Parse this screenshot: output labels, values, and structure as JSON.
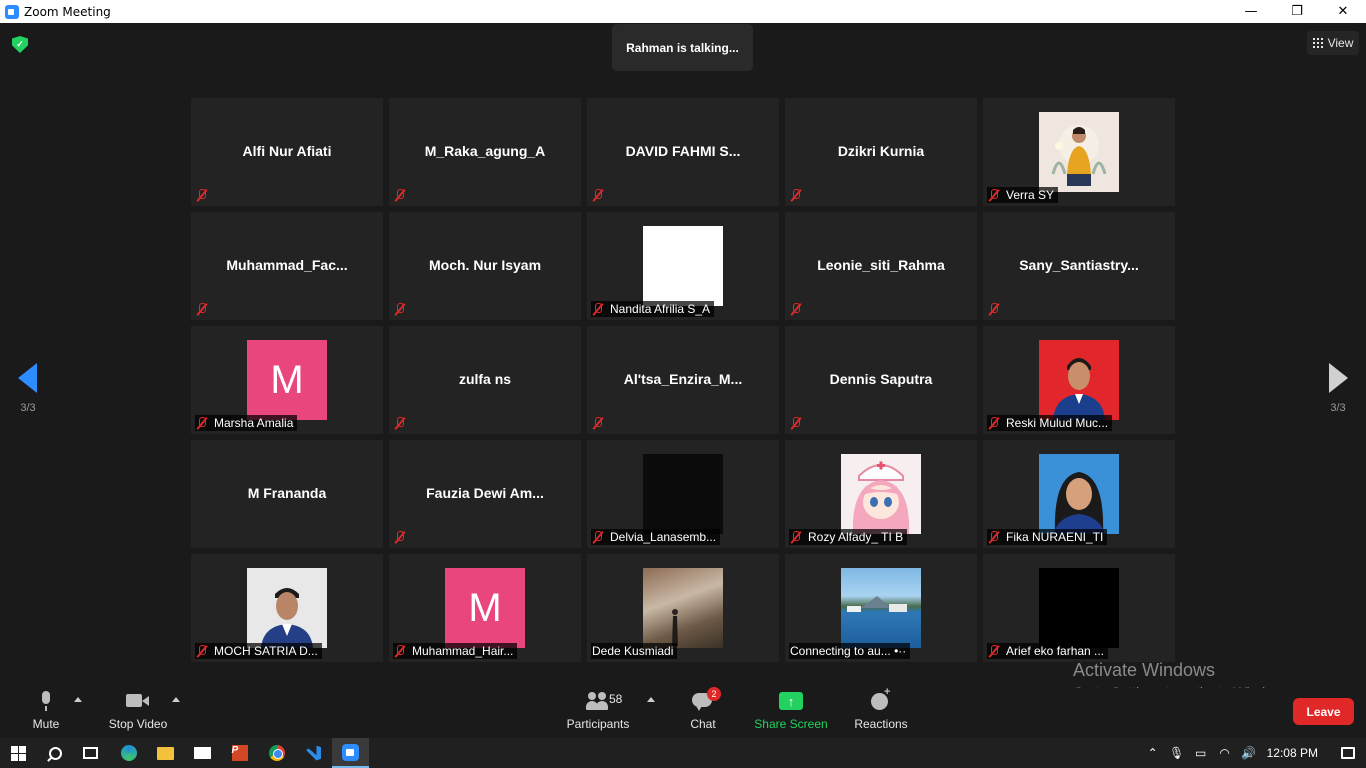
{
  "window": {
    "title": "Zoom Meeting",
    "minimize": "—",
    "restore": "❐",
    "close": "✕"
  },
  "header": {
    "security": "✓",
    "talking": "Rahman is talking...",
    "view_label": "View"
  },
  "nav": {
    "left_page": "3/3",
    "right_page": "3/3"
  },
  "tiles": [
    {
      "name": "Alfi Nur Afiati",
      "label": "",
      "muted": true
    },
    {
      "name": "M_Raka_agung_A",
      "label": "",
      "muted": true
    },
    {
      "name": "DAVID FAHMI S...",
      "label": "",
      "muted": true
    },
    {
      "name": "Dzikri Kurnia",
      "label": "",
      "muted": true
    },
    {
      "name": "",
      "label": "Verra SY",
      "muted": true,
      "avatar": "photo"
    },
    {
      "name": "Muhammad_Fac...",
      "label": "",
      "muted": true
    },
    {
      "name": "Moch. Nur Isyam",
      "label": "",
      "muted": true
    },
    {
      "name": "",
      "label": "Nandita Afrilia S_A",
      "muted": true,
      "avatar": "white"
    },
    {
      "name": "Leonie_siti_Rahma",
      "label": "",
      "muted": true
    },
    {
      "name": "Sany_Santiastry...",
      "label": "",
      "muted": true
    },
    {
      "name": "",
      "label": "Marsha Amalia",
      "muted": true,
      "avatar": "M"
    },
    {
      "name": "zulfa ns",
      "label": "",
      "muted": true
    },
    {
      "name": "Al'tsa_Enzira_M...",
      "label": "",
      "muted": true
    },
    {
      "name": "Dennis Saputra",
      "label": "",
      "muted": true
    },
    {
      "name": "",
      "label": "Reski Mulud Muc...",
      "muted": true,
      "avatar": "photo"
    },
    {
      "name": "M Frananda",
      "label": "",
      "muted": false
    },
    {
      "name": "Fauzia Dewi Am...",
      "label": "",
      "muted": true
    },
    {
      "name": "",
      "label": "Delvia_Lanasemb...",
      "muted": true,
      "avatar": "dark"
    },
    {
      "name": "",
      "label": "Rozy Alfady_ TI B",
      "muted": true,
      "avatar": "photo"
    },
    {
      "name": "",
      "label": "Fika NURAENI_TI",
      "muted": true,
      "avatar": "photo"
    },
    {
      "name": "",
      "label": "MOCH SATRIA D...",
      "muted": true,
      "avatar": "photo"
    },
    {
      "name": "",
      "label": "Muhammad_Hair...",
      "muted": true,
      "avatar": "M"
    },
    {
      "name": "",
      "label": "Dede Kusmiadi",
      "muted": false,
      "avatar": "photo"
    },
    {
      "name": "",
      "label": "Connecting to au... •··",
      "muted": false,
      "avatar": "photo"
    },
    {
      "name": "",
      "label": "Arief eko farhan ...",
      "muted": true,
      "avatar": "black"
    }
  ],
  "avatar_letters": {
    "marsha": "M",
    "hair": "M"
  },
  "toolbar": {
    "mute": "Mute",
    "stop_video": "Stop Video",
    "participants": "Participants",
    "participants_count": "58",
    "chat": "Chat",
    "chat_badge": "2",
    "share_screen": "Share Screen",
    "share_glyph": "↑",
    "reactions": "Reactions",
    "leave": "Leave"
  },
  "watermark": {
    "line1": "Activate Windows",
    "line2": "Go to Settings to activate Windows."
  },
  "taskbar": {
    "clock": "12:08 PM",
    "ppt_letter": "P"
  },
  "colors": {
    "accent": "#2d8cff",
    "share_green": "#23d160",
    "leave_red": "#e02828",
    "muted_red": "#e02828",
    "avatar_pink": "#e8467c"
  }
}
